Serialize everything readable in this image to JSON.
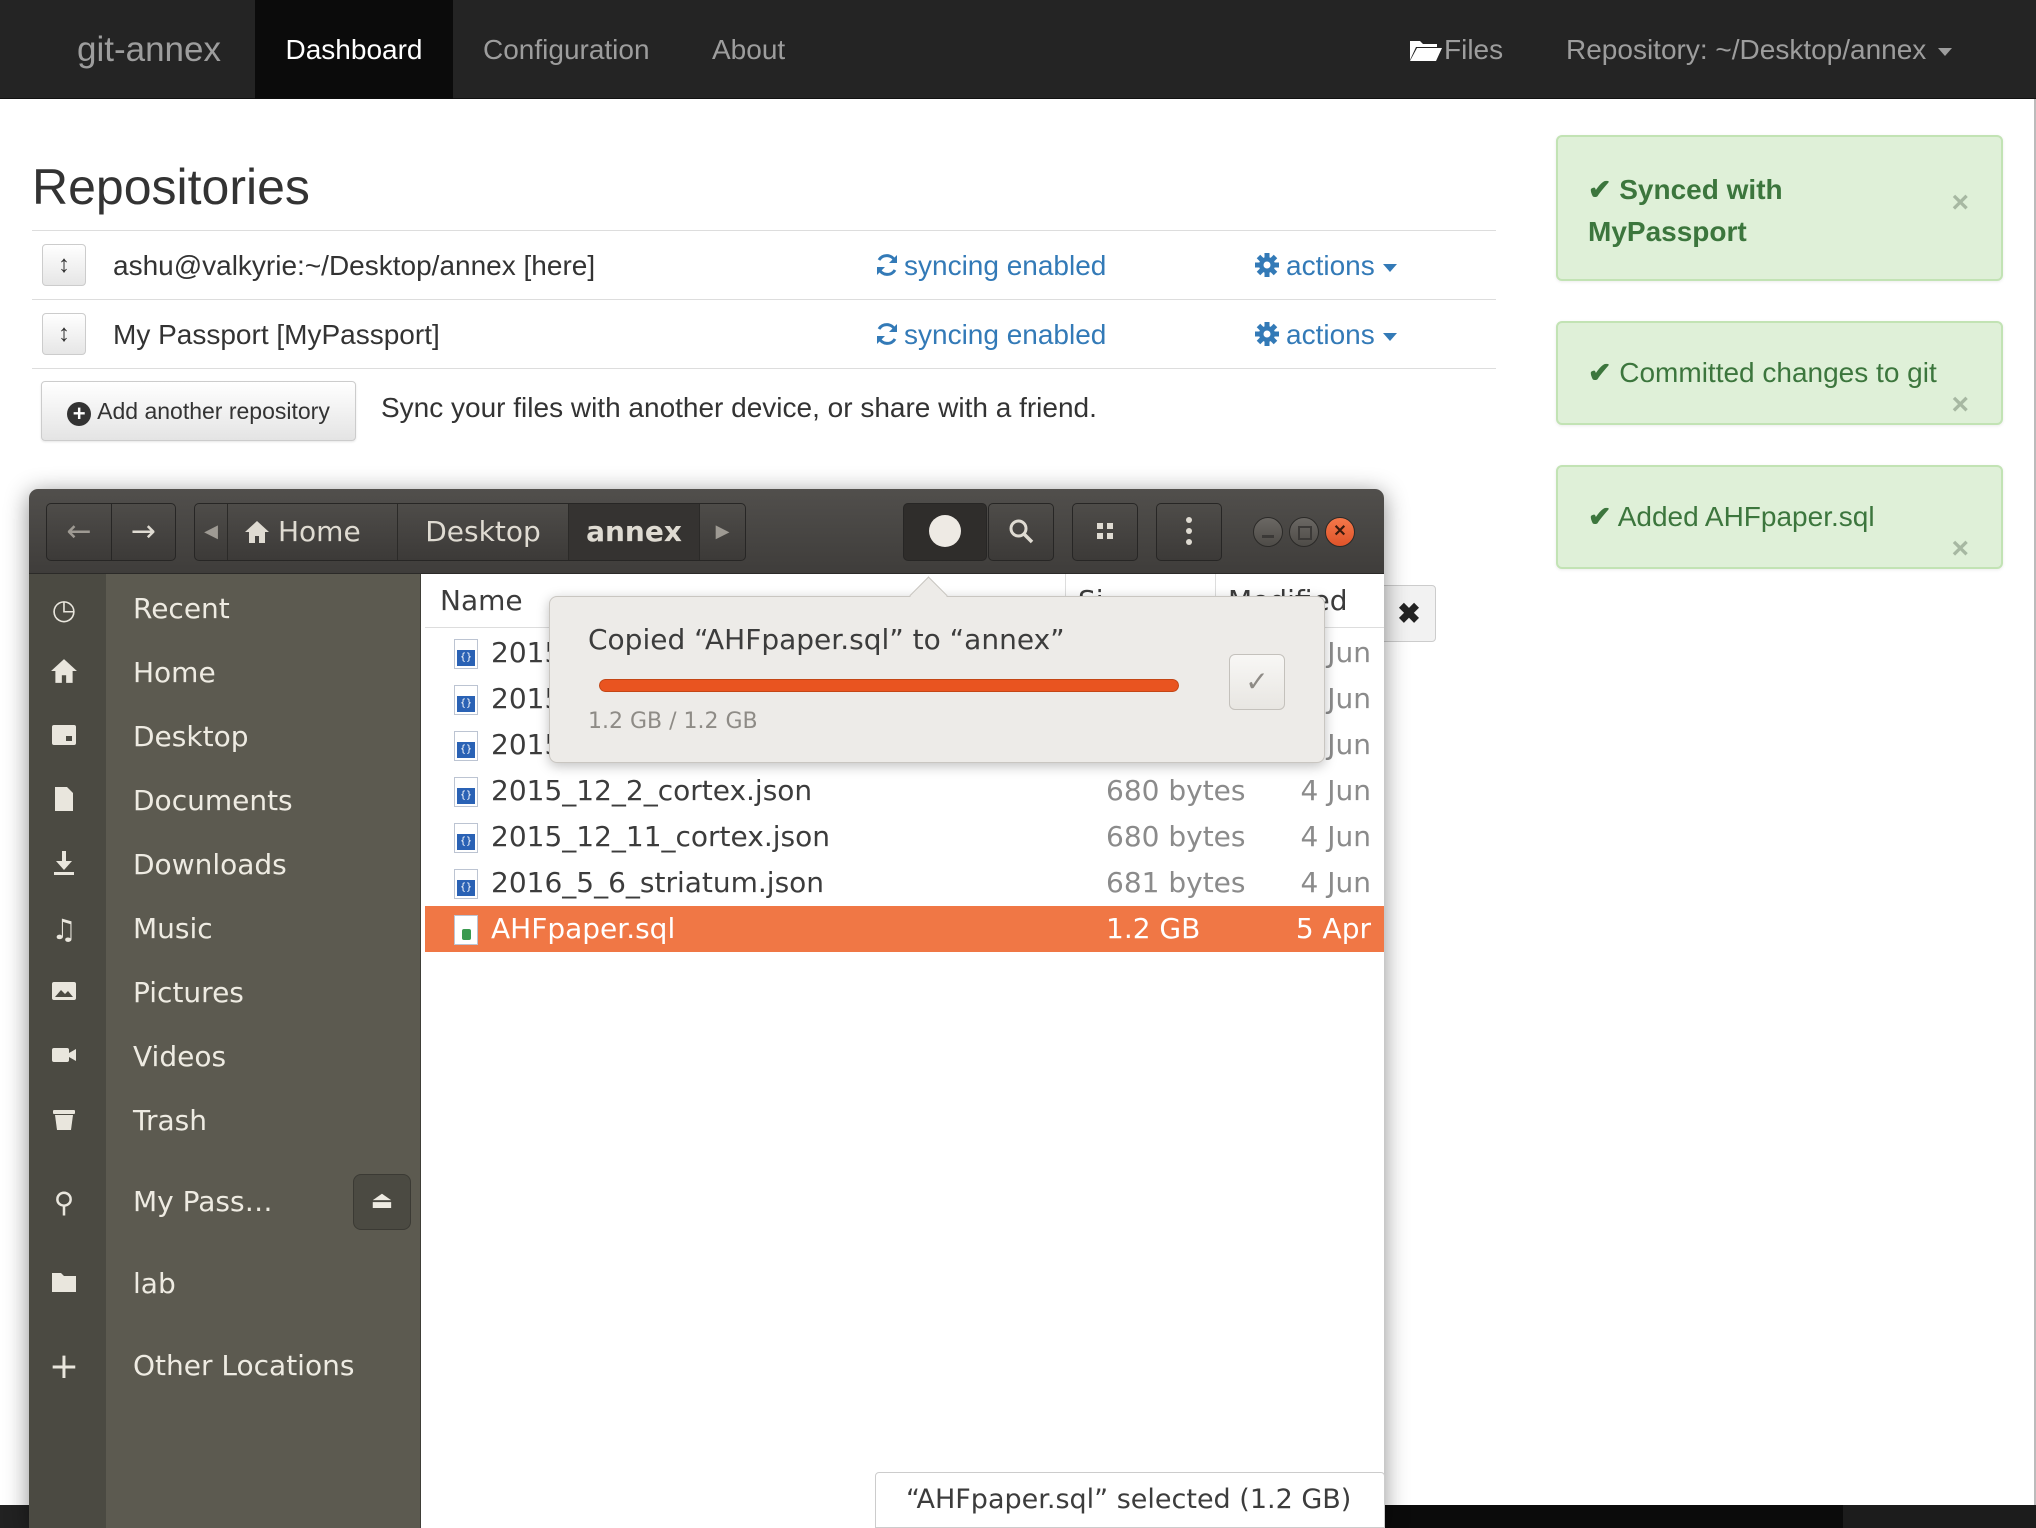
{
  "navbar": {
    "brand": "git-annex",
    "tabs": [
      "Dashboard",
      "Configuration",
      "About"
    ],
    "files_label": "Files",
    "repository_label": "Repository: ~/Desktop/annex"
  },
  "repositories": {
    "title": "Repositories",
    "rows": [
      {
        "name": "ashu@valkyrie:~/Desktop/annex [here]",
        "status": "syncing enabled",
        "actions": "actions"
      },
      {
        "name": "My Passport [MyPassport]",
        "status": "syncing enabled",
        "actions": "actions"
      }
    ],
    "add_button": "Add another repository",
    "add_hint": "Sync your files with another device, or share with a friend."
  },
  "alerts": [
    {
      "line1": "Synced with",
      "line2": "MyPassport"
    },
    {
      "text": "Committed changes to git"
    },
    {
      "text": "Added AHFpaper.sql"
    }
  ],
  "nautilus": {
    "breadcrumbs": [
      "Home",
      "Desktop",
      "annex"
    ],
    "sidebar": [
      "Recent",
      "Home",
      "Desktop",
      "Documents",
      "Downloads",
      "Music",
      "Pictures",
      "Videos",
      "Trash",
      "My Pass…",
      "lab",
      "Other Locations"
    ],
    "columns": {
      "name": "Name",
      "size": "Si",
      "modified": "Modified"
    },
    "files": [
      {
        "name": "2015",
        "size": "",
        "date": "Jun"
      },
      {
        "name": "2015",
        "size": "",
        "date": "Jun"
      },
      {
        "name": "2015",
        "size": "",
        "date": "Jun"
      },
      {
        "name": "2015_12_2_cortex.json",
        "size": "680 bytes",
        "date": "4 Jun"
      },
      {
        "name": "2015_12_11_cortex.json",
        "size": "680 bytes",
        "date": "4 Jun"
      },
      {
        "name": "2016_5_6_striatum.json",
        "size": "681 bytes",
        "date": "4 Jun"
      },
      {
        "name": "AHFpaper.sql",
        "size": "1.2 GB",
        "date": "5 Apr"
      }
    ],
    "status": "“AHFpaper.sql” selected  (1.2 GB)",
    "operation": {
      "title": "Copied “AHFpaper.sql” to “annex”",
      "size": "1.2 GB / 1.2 GB",
      "progress": 1.0
    }
  },
  "colors": {
    "accent_orange": "#f07745",
    "link_blue": "#337ab7",
    "alert_green": "#dff0d8"
  }
}
